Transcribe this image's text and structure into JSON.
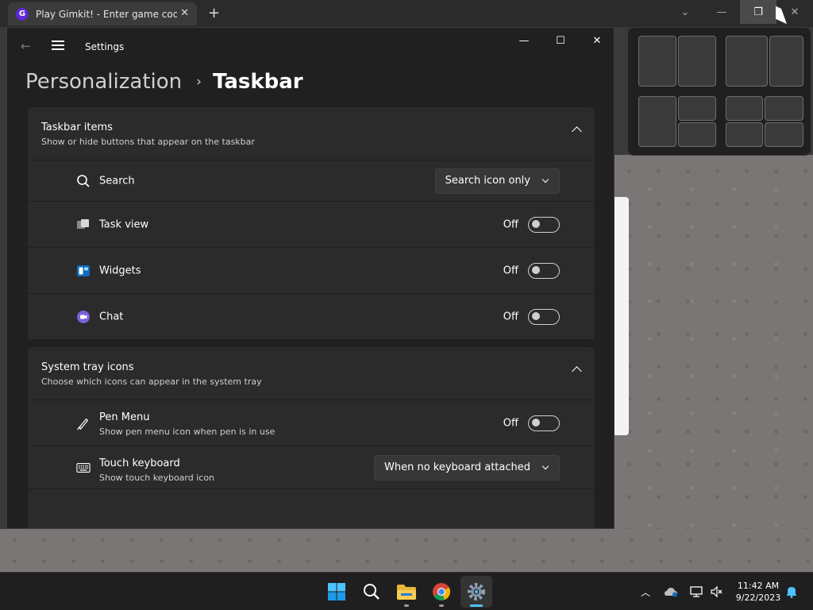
{
  "browser": {
    "tab_title": "Play Gimkit! - Enter game code h",
    "tab_favicon": "G",
    "new_tab_icon": "plus-icon"
  },
  "window": {
    "app_title": "Settings",
    "breadcrumb": {
      "parent": "Personalization",
      "separator": "›",
      "current": "Taskbar"
    }
  },
  "taskbar_items": {
    "title": "Taskbar items",
    "subtitle": "Show or hide buttons that appear on the taskbar",
    "rows": [
      {
        "label": "Search",
        "control": "dropdown",
        "value": "Search icon only",
        "icon": "search-icon"
      },
      {
        "label": "Task view",
        "control": "toggle",
        "state": "Off",
        "on": false,
        "icon": "task-view-icon"
      },
      {
        "label": "Widgets",
        "control": "toggle",
        "state": "Off",
        "on": false,
        "icon": "widgets-icon"
      },
      {
        "label": "Chat",
        "control": "toggle",
        "state": "Off",
        "on": false,
        "icon": "chat-icon"
      }
    ]
  },
  "system_tray": {
    "title": "System tray icons",
    "subtitle": "Choose which icons can appear in the system tray",
    "rows": [
      {
        "label": "Pen Menu",
        "sub": "Show pen menu icon when pen is in use",
        "control": "toggle",
        "state": "Off",
        "on": false,
        "icon": "pen-icon"
      },
      {
        "label": "Touch keyboard",
        "sub": "Show touch keyboard icon",
        "control": "dropdown",
        "value": "When no keyboard attached",
        "icon": "keyboard-icon"
      }
    ]
  },
  "clock": {
    "time": "11:42 AM",
    "date": "9/22/2023"
  },
  "colors": {
    "accent": "#4cc2ff",
    "card": "#2b2b2b",
    "window_bg": "#202020"
  }
}
